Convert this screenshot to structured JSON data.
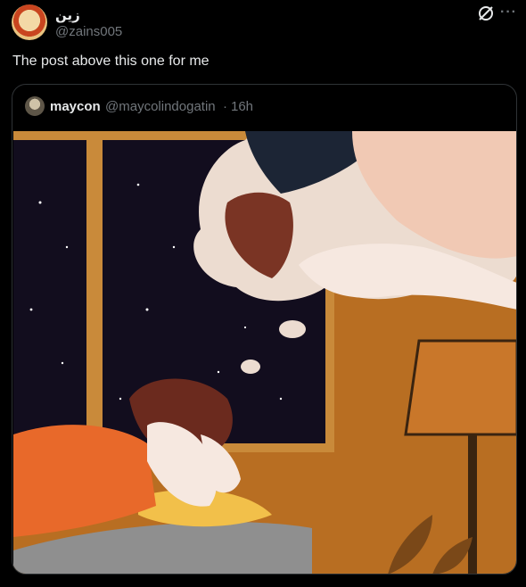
{
  "post": {
    "author_name": "زين",
    "author_handle": "@zains005",
    "text": "The post above this one for me"
  },
  "actions": {
    "grok_icon": "grok-icon",
    "more_label": "···"
  },
  "quoted_post": {
    "author_name": "maycon",
    "author_handle": "@maycolindogatin",
    "separator": "·",
    "time": "16h",
    "media_description_icon": "comic-illustration"
  },
  "colors": {
    "background": "#000000",
    "text_primary": "#e7e9ea",
    "text_secondary": "#71767b",
    "border": "#2f3336"
  }
}
